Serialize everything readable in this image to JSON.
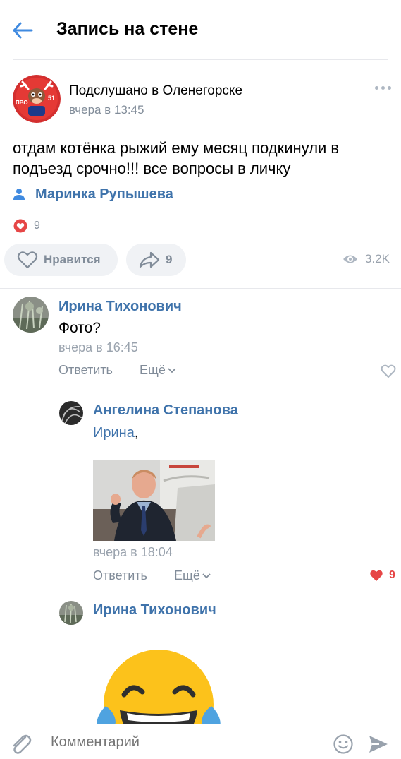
{
  "header": {
    "title": "Запись на стене"
  },
  "post": {
    "author": "Подслушано в Оленегорске",
    "avatar_text_left": "ПВО",
    "avatar_text_right": "51",
    "time": "вчера в 13:45",
    "text": "отдам котёнка рыжий ему месяц подкинули в подъезд срочно!!! все вопросы в личку",
    "signer": "Маринка Рупышева",
    "reactions_count": "9",
    "like_label": "Нравится",
    "share_count": "9",
    "views": "3.2K"
  },
  "comments": [
    {
      "author": "Ирина Тихонович",
      "text": "Фото?",
      "time": "вчера в 16:45",
      "reply_label": "Ответить",
      "more_label": "Ещё"
    },
    {
      "author": "Ангелина Степанова",
      "mention": "Ирина",
      "mention_suffix": ",",
      "time": "вчера в 18:04",
      "reply_label": "Ответить",
      "more_label": "Ещё",
      "likes": "9"
    },
    {
      "author": "Ирина Тихонович"
    }
  ],
  "composer": {
    "placeholder": "Комментарий"
  },
  "colors": {
    "link": "#3f73ab",
    "secondary": "#818c99",
    "like_red": "#e64646"
  }
}
